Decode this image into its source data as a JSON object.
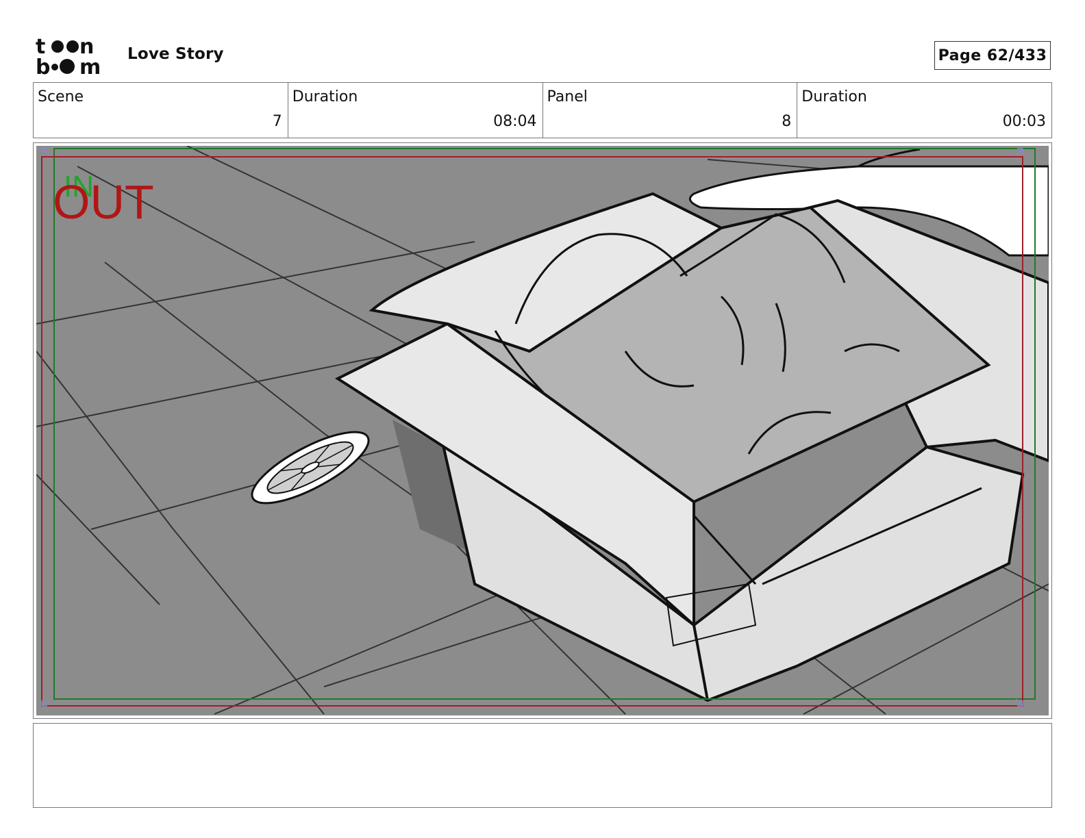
{
  "header": {
    "logo_text": "toon boom",
    "project_title": "Love Story",
    "page_label": "Page",
    "page_number": "62/433"
  },
  "info": {
    "scene_label": "Scene",
    "scene_value": "7",
    "scene_duration_label": "Duration",
    "scene_duration_value": "08:04",
    "panel_label": "Panel",
    "panel_value": "8",
    "panel_duration_label": "Duration",
    "panel_duration_value": "00:03"
  },
  "panel": {
    "in_marker": "IN",
    "out_marker": "OUT",
    "colors": {
      "in_marker": "#1fa52e",
      "out_marker": "#b01616",
      "safe_frame_green": "#1d7a2a",
      "safe_frame_red": "#a31d2a",
      "floor": "#8c8c8c",
      "box": "#e4e4e4"
    }
  },
  "notes": {
    "text": ""
  }
}
